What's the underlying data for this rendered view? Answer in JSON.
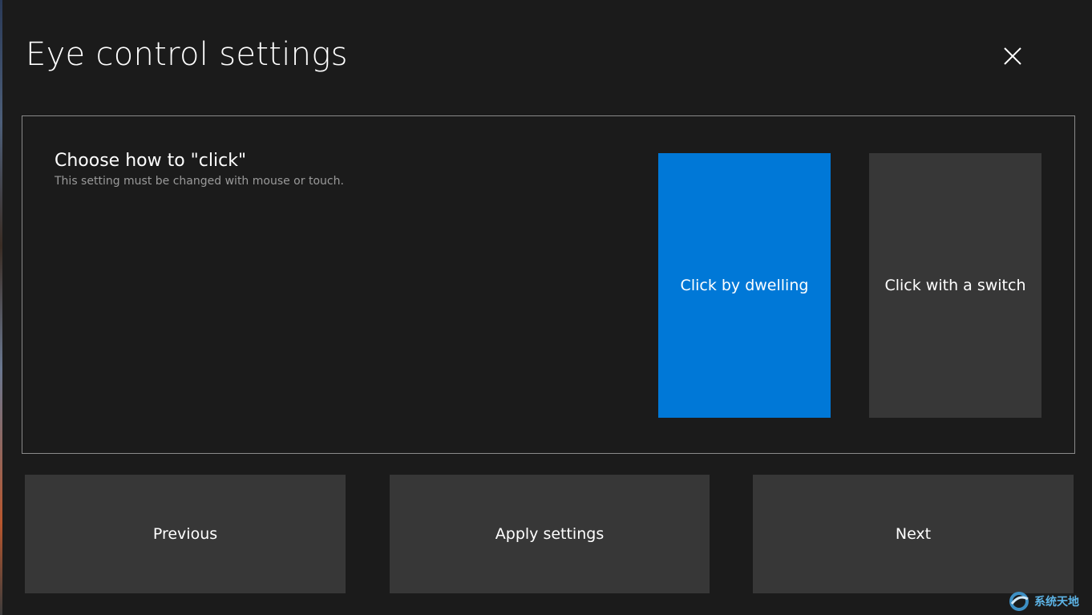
{
  "header": {
    "title": "Eye control settings",
    "close_icon": "close-icon"
  },
  "setting": {
    "heading": "Choose how to \"click\"",
    "description": "This setting must be changed with mouse or touch.",
    "options": [
      {
        "label": "Click by dwelling",
        "selected": true
      },
      {
        "label": "Click with a switch",
        "selected": false
      }
    ]
  },
  "footer": {
    "previous_label": "Previous",
    "apply_label": "Apply settings",
    "next_label": "Next"
  },
  "watermark": {
    "text": "系统天地"
  },
  "colors": {
    "background": "#1b1b1b",
    "accent": "#0078d7",
    "tile": "#373737",
    "border": "#8a8a8a",
    "secondary_text": "#9a9a9a"
  }
}
